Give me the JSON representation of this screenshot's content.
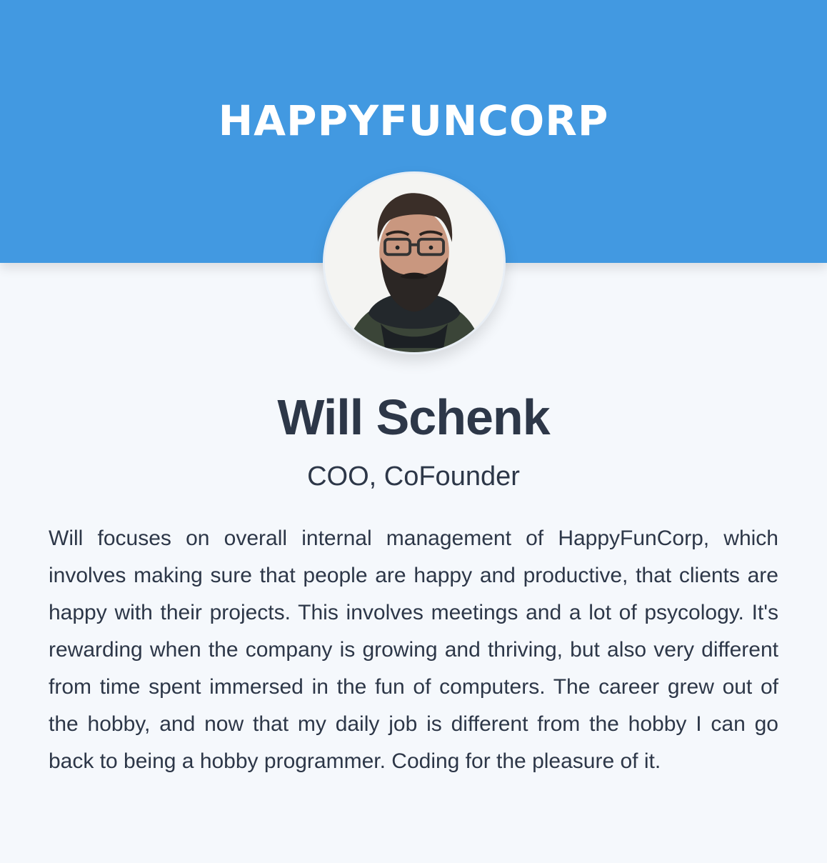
{
  "header": {
    "logo_text": "HAPPYFUNCORP",
    "background_color": "#4299e1"
  },
  "profile": {
    "avatar_alt": "photo of bearded man with glasses",
    "name": "Will Schenk",
    "title": "COO, CoFounder",
    "bio": "Will focuses on overall internal management of HappyFunCorp, which involves making sure that people are happy and productive, that clients are happy with their projects. This involves meetings and a lot of psycology. It's rewarding when the company is growing and thriving, but also very different from time spent immersed in the fun of computers. The career grew out of the hobby, and now that my daily job is different from the hobby I can go back to being a hobby programmer. Coding for the pleasure of it."
  }
}
